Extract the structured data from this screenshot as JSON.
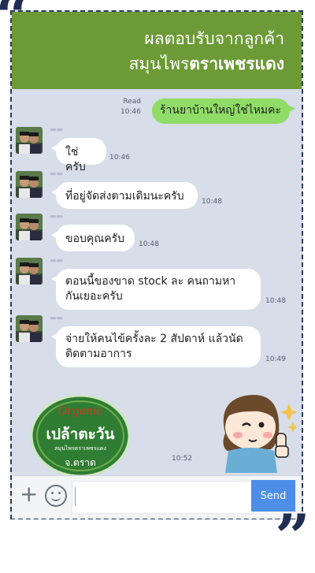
{
  "header": {
    "line1": "ผลตอบรับจากลูกค้า",
    "line2_normal": "สมุนไพร",
    "line2_bold": "ตราเพชรแดง"
  },
  "chat": {
    "sent": {
      "text": "ร้านยาบ้านใหญ่ใช่ไหมคะ",
      "status": "Read",
      "time": "10:46"
    },
    "received": [
      {
        "text_lines": [
          "ใช่ครับ"
        ],
        "time": "10:46"
      },
      {
        "text_lines": [
          "ที่อยู่จัดส่งตามเดิมนะครับ"
        ],
        "time": "10:48"
      },
      {
        "text_lines": [
          "ขอบคุณครับ"
        ],
        "time": "10:48"
      },
      {
        "text_lines": [
          "ตอนนี้ของขาด stock ละ คนถามหา",
          "กันเยอะครับ"
        ],
        "time": "10:48"
      },
      {
        "text_lines": [
          "จ่ายให้คนไข้ครั้งละ 2 สัปดาห์ แล้วนัด",
          "ติดตามอาการ"
        ],
        "time": "10:49"
      }
    ],
    "sticker_time": "10:52"
  },
  "logo": {
    "line1": "Organic",
    "line2": "เปล้าตะวัน",
    "line3": "สมุนไพรตราเพชรแดง",
    "line4": "จ.ตราด"
  },
  "input": {
    "send_label": "Send"
  },
  "colors": {
    "header_green": "#6c9a36",
    "bubble_green": "#8fdc66",
    "chat_bg": "#d7dde9",
    "send_blue": "#4c8ee8"
  }
}
